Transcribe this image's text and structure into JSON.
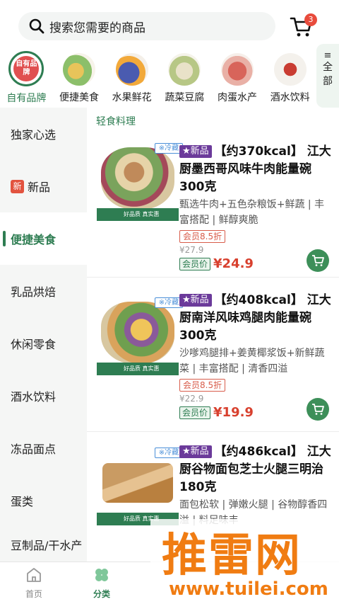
{
  "header": {
    "search_placeholder": "搜索您需要的商品",
    "cart_count": "3"
  },
  "top_categories": [
    {
      "label": "自有品牌",
      "logo_text": "自有品牌",
      "icon": "own-brand-logo"
    },
    {
      "label": "便捷美食",
      "icon": "food-bowl-image"
    },
    {
      "label": "水果鲜花",
      "icon": "fruit-image"
    },
    {
      "label": "蔬菜豆腐",
      "icon": "vegetable-image"
    },
    {
      "label": "肉蛋水产",
      "icon": "meat-image"
    },
    {
      "label": "酒水饮料",
      "icon": "liquor-bottle-image"
    }
  ],
  "all_tab": {
    "icon": "menu-icon",
    "label1": "全",
    "label2": "部"
  },
  "sidebar": {
    "items": [
      {
        "label": "独家心选"
      },
      {
        "label": "新品",
        "badge": "新"
      },
      {
        "label": "便捷美食",
        "active": true
      },
      {
        "label": "乳品烘焙"
      },
      {
        "label": "休闲零食"
      },
      {
        "label": "酒水饮料"
      },
      {
        "label": "冻品面点"
      },
      {
        "label": "蛋类"
      },
      {
        "label": "豆制品/干水产"
      }
    ]
  },
  "section_title": "轻食料理",
  "products": [
    {
      "cold_tag": "※冷藏",
      "new_tag": "★新品",
      "title": "【约370kcal】 江大厨墨西哥风味牛肉能量碗300克",
      "desc": "甄选牛肉+五色杂粮饭+鲜蔬 | 丰富搭配 | 鲜醇爽脆",
      "discount": "会员8.5折",
      "original_price": "¥27.9",
      "member_label": "会员价",
      "member_price": "¥24.9",
      "thumb_footer": "好品质 真实惠"
    },
    {
      "cold_tag": "※冷藏",
      "new_tag": "★新品",
      "title": "【约408kcal】 江大厨南洋风味鸡腿肉能量碗300克",
      "desc": "沙嗲鸡腿排+姜黄椰浆饭+新鲜蔬菜 | 丰富搭配 | 清香四溢",
      "discount": "会员8.5折",
      "original_price": "¥22.9",
      "member_label": "会员价",
      "member_price": "¥19.9",
      "thumb_footer": "好品质 真实惠"
    },
    {
      "cold_tag": "※冷藏",
      "new_tag": "★新品",
      "title": "【约486kcal】 江大厨谷物面包芝士火腿三明治180克",
      "desc": "面包松软 | 弹嫩火腿 | 谷物醇香四溢 | 料足味丰",
      "thumb_footer": "好品质 真实惠"
    }
  ],
  "bottom_nav": [
    {
      "label": "首页",
      "icon": "home-icon"
    },
    {
      "label": "分类",
      "icon": "category-clover-icon",
      "active": true
    }
  ],
  "watermark": {
    "text": "推雷网",
    "url": "www.tuilei.com"
  },
  "colors": {
    "brand_green": "#2e7d52",
    "price_red": "#d8402e",
    "watermark_orange": "#f07c12"
  }
}
